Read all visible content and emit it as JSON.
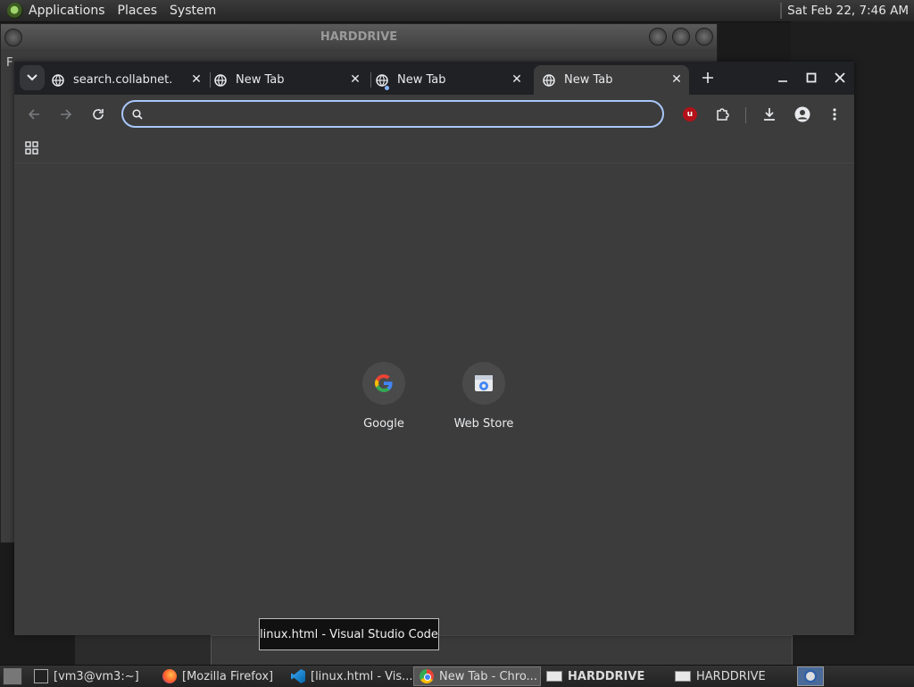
{
  "top_panel": {
    "menus": [
      "Applications",
      "Places",
      "System"
    ],
    "clock": "Sat Feb 22,  7:46 AM"
  },
  "bg_window": {
    "title": "HARDDRIVE",
    "menubar_fragment": "F"
  },
  "chrome": {
    "tabs": [
      {
        "title": "search.collabnet.lo",
        "active": false
      },
      {
        "title": "New Tab",
        "active": false
      },
      {
        "title": "New Tab",
        "active": false,
        "loading_dot": true
      },
      {
        "title": "New Tab",
        "active": true
      }
    ],
    "omnibox": {
      "value": "",
      "placeholder": ""
    },
    "extension_badge": "u",
    "shortcuts": [
      {
        "label": "Google",
        "icon": "google-g-icon"
      },
      {
        "label": "Web Store",
        "icon": "web-store-icon"
      }
    ]
  },
  "tooltip": "linux.html - Visual Studio Code",
  "taskbar": {
    "items": [
      {
        "label": "[vm3@vm3:~]",
        "icon": "terminal-icon"
      },
      {
        "label": "[Mozilla Firefox]",
        "icon": "firefox-icon"
      },
      {
        "label": "[linux.html - Vis...",
        "icon": "vscode-icon"
      },
      {
        "label": "New Tab - Chro...",
        "icon": "chrome-icon",
        "active": true
      },
      {
        "label": "HARDDRIVE",
        "icon": "drive-icon",
        "bold": true
      },
      {
        "label": "HARDDRIVE",
        "icon": "drive-icon"
      }
    ]
  },
  "colors": {
    "focus_ring": "#a8c7fa",
    "tab_strip": "#202124",
    "toolbar": "#3c3c3c"
  }
}
